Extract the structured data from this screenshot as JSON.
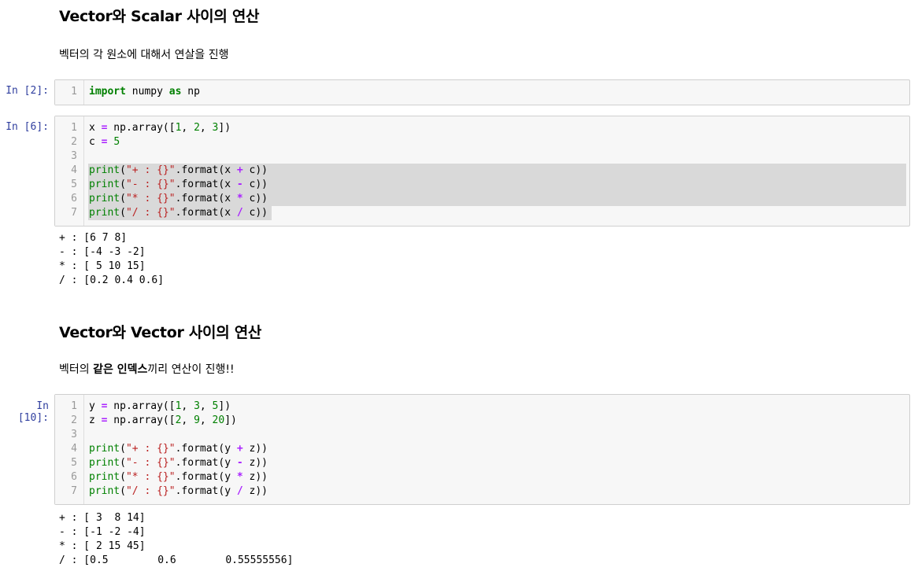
{
  "section1": {
    "heading": "Vector와 Scalar 사이의 연산",
    "desc": "벡터의 각 원소에 대해서 연살을 진행"
  },
  "cell1": {
    "prompt": "In [2]:",
    "lines": [
      {
        "n": "1",
        "parts": [
          [
            "kw",
            "import"
          ],
          [
            "",
            " numpy "
          ],
          [
            "kw",
            "as"
          ],
          [
            "",
            " np"
          ]
        ]
      }
    ]
  },
  "cell2": {
    "prompt": "In [6]:",
    "lines": [
      {
        "n": "1",
        "parts": [
          [
            "",
            "x "
          ],
          [
            "op",
            "="
          ],
          [
            "",
            " np.array(["
          ],
          [
            "num",
            "1"
          ],
          [
            "",
            ", "
          ],
          [
            "num",
            "2"
          ],
          [
            "",
            ", "
          ],
          [
            "num",
            "3"
          ],
          [
            "",
            "])"
          ]
        ]
      },
      {
        "n": "2",
        "parts": [
          [
            "",
            "c "
          ],
          [
            "op",
            "="
          ],
          [
            "",
            " "
          ],
          [
            "num",
            "5"
          ]
        ]
      },
      {
        "n": "3",
        "parts": []
      },
      {
        "n": "4",
        "parts": [
          [
            "fn",
            "print"
          ],
          [
            "",
            "("
          ],
          [
            "str",
            "\"+ : {}\""
          ],
          [
            "",
            ".format(x "
          ],
          [
            "op",
            "+"
          ],
          [
            "",
            " c))"
          ]
        ]
      },
      {
        "n": "5",
        "parts": [
          [
            "fn",
            "print"
          ],
          [
            "",
            "("
          ],
          [
            "str",
            "\"- : {}\""
          ],
          [
            "",
            ".format(x "
          ],
          [
            "op",
            "-"
          ],
          [
            "",
            " c))"
          ]
        ]
      },
      {
        "n": "6",
        "parts": [
          [
            "fn",
            "print"
          ],
          [
            "",
            "("
          ],
          [
            "str",
            "\"* : {}\""
          ],
          [
            "",
            ".format(x "
          ],
          [
            "op",
            "*"
          ],
          [
            "",
            " c))"
          ]
        ]
      },
      {
        "n": "7",
        "parts": [
          [
            "fn",
            "print"
          ],
          [
            "",
            "("
          ],
          [
            "str",
            "\"/ : {}\""
          ],
          [
            "",
            ".format(x "
          ],
          [
            "op",
            "/"
          ],
          [
            "",
            " c))"
          ]
        ]
      }
    ],
    "output": [
      "+ : [6 7 8]",
      "- : [-4 -3 -2]",
      "* : [ 5 10 15]",
      "/ : [0.2 0.4 0.6]"
    ]
  },
  "section2": {
    "heading": "Vector와 Vector 사이의 연산",
    "desc_pre": "벡터의 ",
    "desc_bold": "같은 인덱스",
    "desc_post": "끼리 연산이 진행!!"
  },
  "cell3": {
    "prompt": "In [10]:",
    "lines": [
      {
        "n": "1",
        "parts": [
          [
            "",
            "y "
          ],
          [
            "op",
            "="
          ],
          [
            "",
            " np.array(["
          ],
          [
            "num",
            "1"
          ],
          [
            "",
            ", "
          ],
          [
            "num",
            "3"
          ],
          [
            "",
            ", "
          ],
          [
            "num",
            "5"
          ],
          [
            "",
            "])"
          ]
        ]
      },
      {
        "n": "2",
        "parts": [
          [
            "",
            "z "
          ],
          [
            "op",
            "="
          ],
          [
            "",
            " np.array(["
          ],
          [
            "num",
            "2"
          ],
          [
            "",
            ", "
          ],
          [
            "num",
            "9"
          ],
          [
            "",
            ", "
          ],
          [
            "num",
            "20"
          ],
          [
            "",
            "])"
          ]
        ]
      },
      {
        "n": "3",
        "parts": []
      },
      {
        "n": "4",
        "parts": [
          [
            "fn",
            "print"
          ],
          [
            "",
            "("
          ],
          [
            "str",
            "\"+ : {}\""
          ],
          [
            "",
            ".format(y "
          ],
          [
            "op",
            "+"
          ],
          [
            "",
            " z))"
          ]
        ]
      },
      {
        "n": "5",
        "parts": [
          [
            "fn",
            "print"
          ],
          [
            "",
            "("
          ],
          [
            "str",
            "\"- : {}\""
          ],
          [
            "",
            ".format(y "
          ],
          [
            "op",
            "-"
          ],
          [
            "",
            " z))"
          ]
        ]
      },
      {
        "n": "6",
        "parts": [
          [
            "fn",
            "print"
          ],
          [
            "",
            "("
          ],
          [
            "str",
            "\"* : {}\""
          ],
          [
            "",
            ".format(y "
          ],
          [
            "op",
            "*"
          ],
          [
            "",
            " z))"
          ]
        ]
      },
      {
        "n": "7",
        "parts": [
          [
            "fn",
            "print"
          ],
          [
            "",
            "("
          ],
          [
            "str",
            "\"/ : {}\""
          ],
          [
            "",
            ".format(y "
          ],
          [
            "op",
            "/"
          ],
          [
            "",
            " z))"
          ]
        ]
      }
    ],
    "output": [
      "+ : [ 3  8 14]",
      "- : [-1 -2 -4]",
      "* : [ 2 15 45]",
      "/ : [0.5        0.6        0.55555556]"
    ]
  }
}
